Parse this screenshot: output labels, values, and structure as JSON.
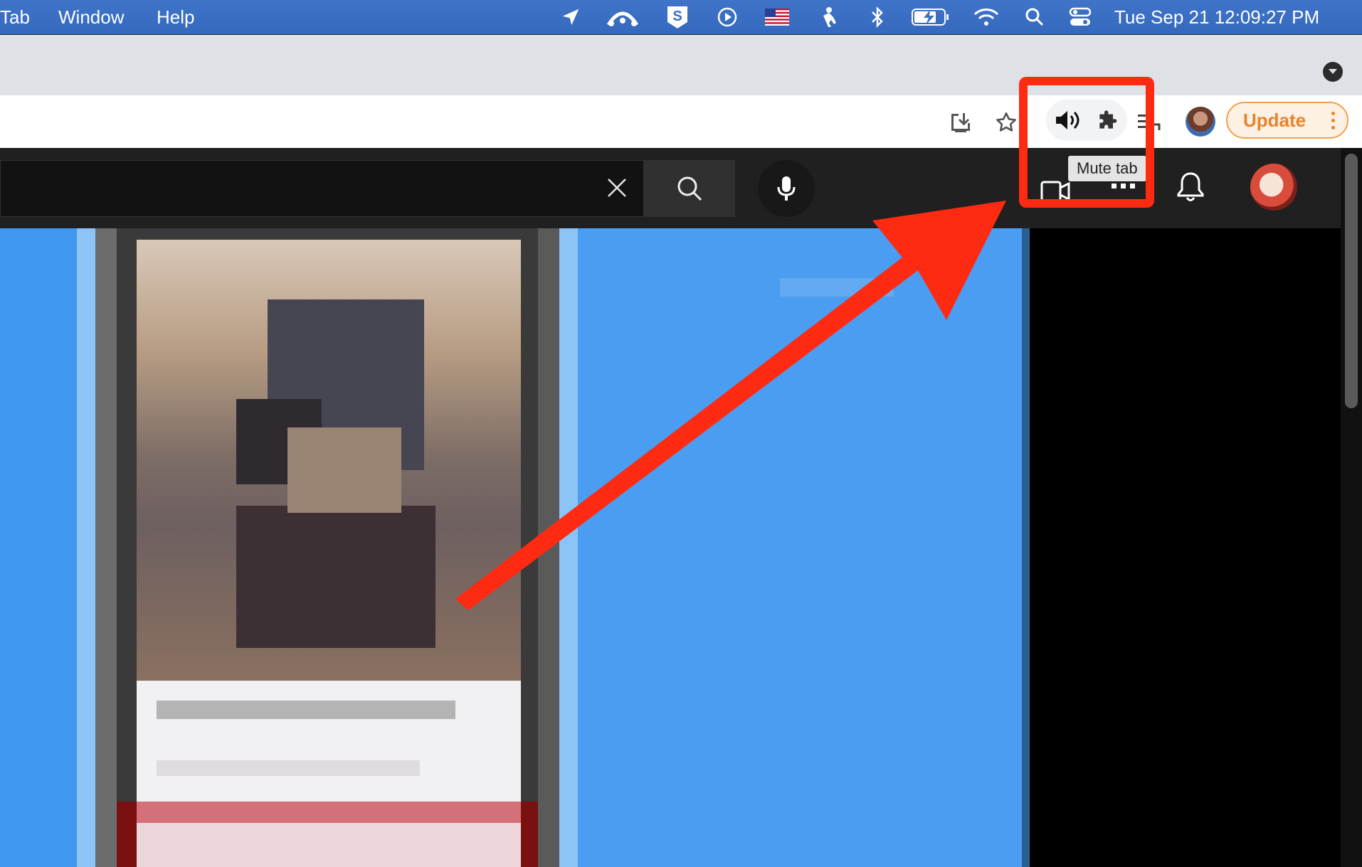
{
  "menubar": {
    "items": [
      "Tab",
      "Window",
      "Help"
    ],
    "clock": "Tue Sep 21  12:09:27 PM",
    "icons": [
      "location-arrow-icon",
      "cloud-sync-icon",
      "s-app-icon",
      "play-circle-icon",
      "us-flag-icon",
      "figure-icon",
      "bluetooth-icon",
      "battery-charging-icon",
      "wifi-icon",
      "spotlight-search-icon",
      "control-center-icon"
    ]
  },
  "toolbar": {
    "update_label": "Update",
    "tooltip": "Mute tab"
  },
  "colors": {
    "annotation": "#ff2a12",
    "update_accent": "#e8832b",
    "menubar": "#3a6fc3",
    "page_blue": "#4a9df0"
  }
}
